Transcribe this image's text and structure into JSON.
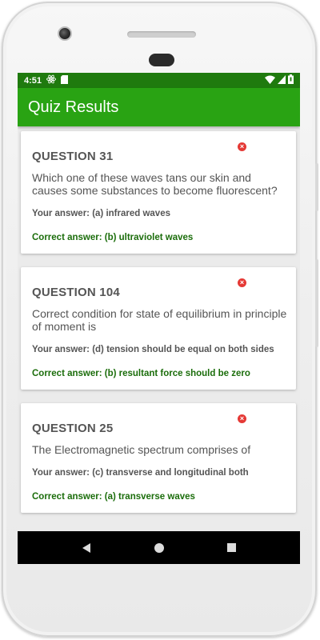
{
  "status_bar": {
    "time": "4:51",
    "icons": [
      "react-icon",
      "sd-card-icon",
      "wifi-icon",
      "signal-icon",
      "battery-icon"
    ]
  },
  "app_bar": {
    "title": "Quiz Results"
  },
  "cards": [
    {
      "title": "QUESTION 31",
      "question": "Which one of these waves tans our skin and causes some substances to become fluorescent?",
      "your_answer": "Your answer: (a) infrared waves",
      "correct_answer": "Correct answer: (b) ultraviolet waves"
    },
    {
      "title": "QUESTION 104",
      "question": "Correct condition for state of equilibrium in principle of moment is",
      "your_answer": "Your answer: (d) tension should be equal on both sides",
      "correct_answer": "Correct answer: (b) resultant force should be zero"
    },
    {
      "title": "QUESTION 25",
      "question": "The Electromagnetic spectrum comprises of",
      "your_answer": "Your answer: (c) transverse and longitudinal both",
      "correct_answer": "Correct answer: (a) transverse waves"
    }
  ],
  "nav": {
    "icons": [
      "back-icon",
      "home-icon",
      "recents-icon"
    ]
  },
  "colors": {
    "status_bar": "#1f7a0e",
    "app_bar": "#29a313",
    "correct_text": "#1b6d0b",
    "wrong_icon": "#e53935"
  }
}
